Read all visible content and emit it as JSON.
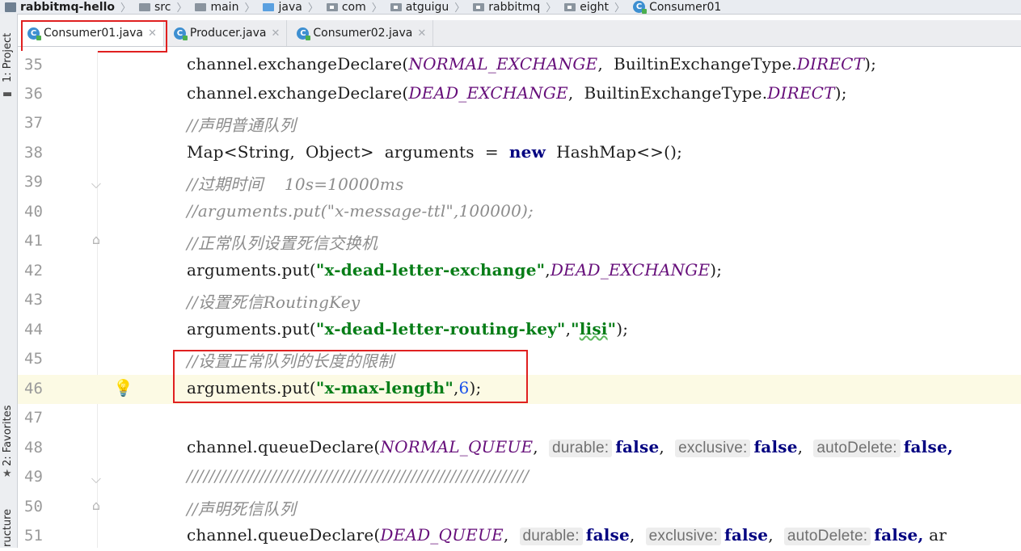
{
  "breadcrumbs": [
    {
      "label": "rabbitmq-hello",
      "icon": "project-icon",
      "bold": true
    },
    {
      "label": "src",
      "icon": "folder-icon"
    },
    {
      "label": "main",
      "icon": "folder-icon"
    },
    {
      "label": "java",
      "icon": "source-folder-icon"
    },
    {
      "label": "com",
      "icon": "package-icon"
    },
    {
      "label": "atguigu",
      "icon": "package-icon"
    },
    {
      "label": "rabbitmq",
      "icon": "package-icon"
    },
    {
      "label": "eight",
      "icon": "package-icon"
    },
    {
      "label": "Consumer01",
      "icon": "class-icon"
    }
  ],
  "tabs": [
    {
      "label": "Consumer01.java",
      "active": true
    },
    {
      "label": "Producer.java",
      "active": false
    },
    {
      "label": "Consumer02.java",
      "active": false
    }
  ],
  "tool_strip": {
    "project": "1: Project",
    "favorites": "2: Favorites",
    "structure": "ructure"
  },
  "editor": {
    "line_numbers": [
      "35",
      "36",
      "37",
      "38",
      "39",
      "40",
      "41",
      "42",
      "43",
      "44",
      "45",
      "46",
      "47",
      "48",
      "49",
      "50",
      "51"
    ],
    "highlighted_line": "46",
    "lines": {
      "l35": {
        "a": "channel.exchangeDeclare(",
        "b": "NORMAL_EXCHANGE",
        ",  BuiltinExchangeType.": "",
        "c": "DIRECT",
        "d": ");"
      },
      "l36": {
        "a": "channel.exchangeDeclare(",
        "b": "DEAD_EXCHANGE",
        "c": ",  BuiltinExchangeType.",
        "d": "DIRECT",
        "e": ");"
      },
      "l37": {
        "comment": "//声明普通队列"
      },
      "l38": {
        "a": "Map<String,  Object>  arguments  =  ",
        "kw": "new",
        "b": "  HashMap<>();"
      },
      "l39": {
        "comment": "//过期时间    10s=10000ms"
      },
      "l40": {
        "comment": "//arguments.put(\"x-message-ttl\",100000);"
      },
      "l41": {
        "comment": "//正常队列设置死信交换机"
      },
      "l42": {
        "a": "arguments.put(",
        "s": "\"x-dead-letter-exchange\"",
        "b": ",",
        "c": "DEAD_EXCHANGE",
        "d": ");"
      },
      "l43": {
        "comment": "//设置死信RoutingKey"
      },
      "l44": {
        "a": "arguments.put(",
        "s": "\"x-dead-letter-routing-key\"",
        "b": ",",
        "s2a": "\"",
        "s2": "lisi",
        "s2b": "\"",
        "c": ");"
      },
      "l45": {
        "comment": "//设置正常队列的长度的限制"
      },
      "l46": {
        "a": "arguments.put(",
        "s": "\"x-max-length\"",
        "b": ",",
        "n": "6",
        "c": ");"
      },
      "l48": {
        "a": "channel.queueDeclare(",
        "b": "NORMAL_QUEUE",
        ",": ",",
        "h1": "durable:",
        "v1": "false",
        "h2": "exclusive:",
        "v2": "false",
        "h3": "autoDelete:",
        "v3": "false,"
      },
      "l49": {
        "comment": "/////////////////////////////////////////////////////////////"
      },
      "l50": {
        "comment": "//声明死信队列"
      },
      "l51": {
        "a": "channel.queueDeclare(",
        "b": "DEAD_QUEUE",
        "h1": "durable:",
        "v1": "false",
        "h2": "exclusive:",
        "v2": "false",
        "h3": "autoDelete:",
        "v3": "false,",
        "tail": "ar"
      }
    }
  },
  "colors": {
    "annotation_box": "#e02020",
    "highlight_line": "#fcfae4"
  }
}
